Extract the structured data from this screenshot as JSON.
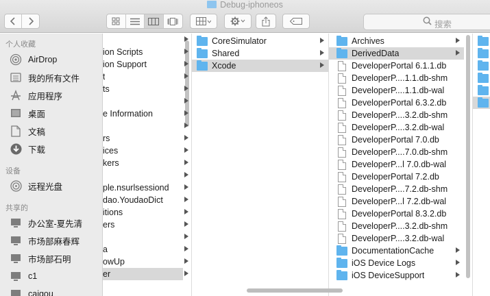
{
  "window": {
    "title": "Debug-iphoneos"
  },
  "toolbar": {
    "search_placeholder": "搜索"
  },
  "sidebar": {
    "favorites_header": "个人收藏",
    "favorites": [
      {
        "label": "AirDrop",
        "icon": "airdrop-icon"
      },
      {
        "label": "我的所有文件",
        "icon": "all-files-icon"
      },
      {
        "label": "应用程序",
        "icon": "applications-icon"
      },
      {
        "label": "桌面",
        "icon": "desktop-icon"
      },
      {
        "label": "文稿",
        "icon": "documents-icon"
      },
      {
        "label": "下载",
        "icon": "downloads-icon"
      }
    ],
    "devices_header": "设备",
    "devices": [
      {
        "label": "远程光盘",
        "icon": "remote-disc-icon"
      }
    ],
    "shared_header": "共享的",
    "shared": [
      {
        "label": "办公室-夏先清",
        "icon": "computer-icon"
      },
      {
        "label": "市场部麻春辉",
        "icon": "computer-icon"
      },
      {
        "label": "市场部石明",
        "icon": "computer-icon"
      },
      {
        "label": "c1",
        "icon": "computer-icon"
      },
      {
        "label": "caigou",
        "icon": "computer-icon"
      }
    ]
  },
  "column1": [
    {
      "label": "",
      "arrow": true
    },
    {
      "label": "ion Scripts",
      "arrow": true
    },
    {
      "label": "ion Support",
      "arrow": true
    },
    {
      "label": "t",
      "arrow": true
    },
    {
      "label": "ts",
      "arrow": true
    },
    {
      "label": "",
      "arrow": true
    },
    {
      "label": "e Information",
      "arrow": true
    },
    {
      "label": "",
      "arrow": true
    },
    {
      "label": "rs",
      "arrow": true
    },
    {
      "label": "ices",
      "arrow": true
    },
    {
      "label": "kers",
      "arrow": true
    },
    {
      "label": "",
      "arrow": true
    },
    {
      "label": "ple.nsurlsessiond",
      "arrow": true
    },
    {
      "label": "dao.YoudaoDict",
      "arrow": true
    },
    {
      "label": "itions",
      "arrow": true
    },
    {
      "label": "ers",
      "arrow": true
    },
    {
      "label": "",
      "arrow": true
    },
    {
      "label": "a",
      "arrow": true
    },
    {
      "label": "owUp",
      "arrow": true
    },
    {
      "label": "er",
      "arrow": true,
      "selected": true
    }
  ],
  "column2": [
    {
      "label": "CoreSimulator",
      "arrow": true
    },
    {
      "label": "Shared",
      "arrow": true
    },
    {
      "label": "Xcode",
      "arrow": true,
      "selected": true
    }
  ],
  "column3": [
    {
      "label": "Archives",
      "type": "folder",
      "arrow": true
    },
    {
      "label": "DerivedData",
      "type": "folder",
      "arrow": true,
      "selected": true
    },
    {
      "label": "DeveloperPortal 6.1.1.db",
      "type": "file"
    },
    {
      "label": "DeveloperP....1.1.db-shm",
      "type": "file"
    },
    {
      "label": "DeveloperP....1.1.db-wal",
      "type": "file"
    },
    {
      "label": "DeveloperPortal 6.3.2.db",
      "type": "file"
    },
    {
      "label": "DeveloperP....3.2.db-shm",
      "type": "file"
    },
    {
      "label": "DeveloperP....3.2.db-wal",
      "type": "file"
    },
    {
      "label": "DeveloperPortal 7.0.db",
      "type": "file"
    },
    {
      "label": "DeveloperP....7.0.db-shm",
      "type": "file"
    },
    {
      "label": "DeveloperP...l 7.0.db-wal",
      "type": "file"
    },
    {
      "label": "DeveloperPortal 7.2.db",
      "type": "file"
    },
    {
      "label": "DeveloperP....7.2.db-shm",
      "type": "file"
    },
    {
      "label": "DeveloperP...l 7.2.db-wal",
      "type": "file"
    },
    {
      "label": "DeveloperPortal 8.3.2.db",
      "type": "file"
    },
    {
      "label": "DeveloperP....3.2.db-shm",
      "type": "file"
    },
    {
      "label": "DeveloperP....3.2.db-wal",
      "type": "file"
    },
    {
      "label": "DocumentationCache",
      "type": "folder",
      "arrow": true
    },
    {
      "label": "iOS Device Logs",
      "type": "folder",
      "arrow": true
    },
    {
      "label": "iOS DeviceSupport",
      "type": "folder",
      "arrow": true
    }
  ],
  "column4_folder_count": 6
}
